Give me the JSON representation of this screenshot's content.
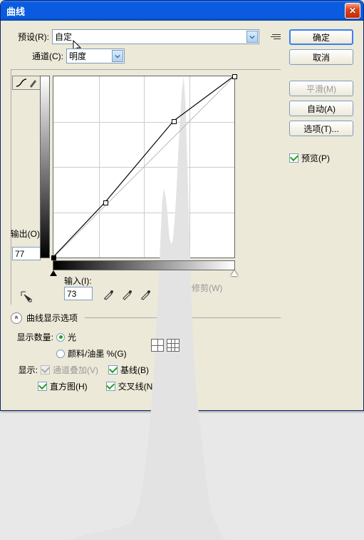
{
  "title": "曲线",
  "preset": {
    "label": "预设(R):",
    "value": "自定"
  },
  "channel": {
    "label": "通道(C):",
    "value": "明度"
  },
  "output": {
    "label": "输出(O):",
    "value": "77"
  },
  "input": {
    "label": "输入(I):",
    "value": "73"
  },
  "show_clip": "显示修剪(W)",
  "display_options_head": "曲线显示选项",
  "show_amount_label": "显示数量:",
  "radio_light": "光",
  "radio_ink": "颜料/油墨 %(G)",
  "show_label": "显示:",
  "chk_channel_overlay": "通道叠加(V)",
  "chk_baseline": "基线(B)",
  "chk_histogram": "直方图(H)",
  "chk_crosshair": "交叉线(N)",
  "buttons": {
    "ok": "确定",
    "cancel": "取消",
    "smooth": "平滑(M)",
    "auto": "自动(A)",
    "options": "选项(T)..."
  },
  "preview_chk": "预览(P)",
  "chart_data": {
    "type": "line",
    "title": "曲线",
    "xlabel": "输入",
    "ylabel": "输出",
    "xlim": [
      0,
      255
    ],
    "ylim": [
      0,
      255
    ],
    "series": [
      {
        "name": "baseline",
        "x": [
          0,
          255
        ],
        "y": [
          0,
          255
        ]
      },
      {
        "name": "curve",
        "points": [
          {
            "x": 0,
            "y": 0,
            "selected": true
          },
          {
            "x": 73,
            "y": 77
          },
          {
            "x": 170,
            "y": 192
          },
          {
            "x": 255,
            "y": 255
          }
        ]
      }
    ],
    "histogram": [
      0,
      0,
      0,
      0,
      0,
      0,
      0,
      0,
      0,
      0,
      1,
      1,
      1,
      1,
      2,
      2,
      2,
      2,
      3,
      3,
      3,
      3,
      3,
      4,
      4,
      4,
      4,
      4,
      5,
      5,
      5,
      5,
      5,
      6,
      6,
      6,
      6,
      7,
      7,
      7,
      8,
      8,
      8,
      9,
      10,
      12,
      14,
      17,
      21,
      26,
      32,
      39,
      47,
      56,
      66,
      78,
      92,
      108,
      126,
      147,
      168,
      176,
      172,
      164,
      152,
      148,
      150,
      160,
      175,
      194,
      210,
      225,
      232,
      218,
      190,
      158,
      128,
      104,
      86,
      74,
      66,
      58,
      50,
      42,
      34,
      26,
      20,
      16,
      12,
      10,
      8,
      6,
      4,
      2,
      1,
      0,
      0,
      0,
      0,
      0
    ]
  }
}
